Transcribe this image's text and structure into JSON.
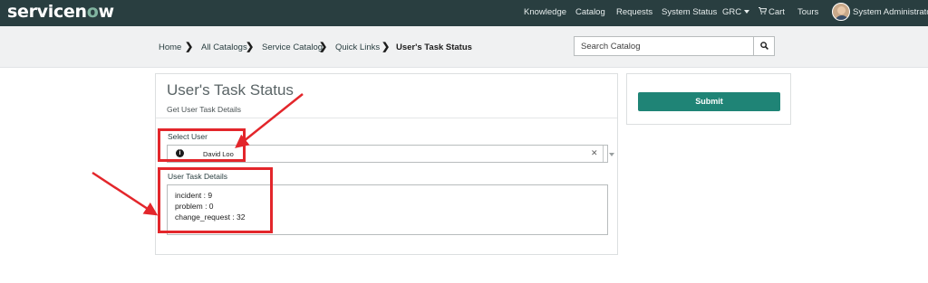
{
  "brand": {
    "logo_text_a": "servicen",
    "logo_text_o": "o",
    "logo_text_b": "w"
  },
  "nav": {
    "knowledge": "Knowledge",
    "catalog": "Catalog",
    "requests": "Requests",
    "system_status": "System Status",
    "grc": "GRC",
    "cart": "Cart",
    "tours": "Tours",
    "user": "System Administrator"
  },
  "breadcrumb": {
    "home": "Home",
    "all_catalogs": "All Catalogs",
    "service_catalog": "Service Catalog",
    "quick_links": "Quick Links",
    "current": "User's Task Status"
  },
  "search": {
    "placeholder": "Search Catalog"
  },
  "form": {
    "title": "User's Task Status",
    "subtitle": "Get User Task Details",
    "select_user_label": "Select User",
    "select_user_value": "David Loo",
    "details_label": "User Task Details",
    "details_lines": [
      "incident : 9",
      "problem : 0",
      "change_request : 32"
    ]
  },
  "submit_label": "Submit",
  "colors": {
    "topbar": "#293e40",
    "accent": "#1f8476",
    "annotation": "#e3262b"
  }
}
